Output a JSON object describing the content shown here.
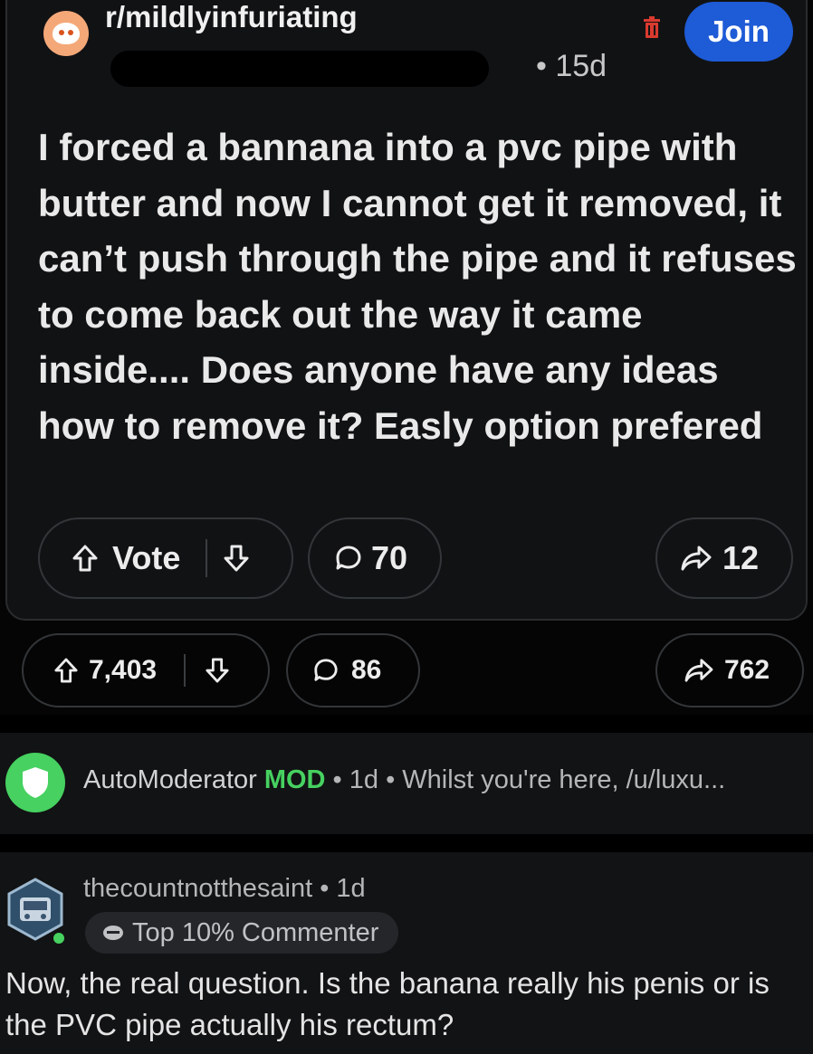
{
  "embedded_post": {
    "subreddit": "r/mildlyinfuriating",
    "age": "• 15d",
    "join_label": "Join",
    "title": "I forced a bannana into a pvc pipe with butter and now I cannot get it removed, it can’t push through the pipe and it refuses to come back out the way it came inside.... Does anyone have any ideas how to remove it? Easly option prefered",
    "vote_label": "Vote",
    "comments": "70",
    "shares": "12"
  },
  "post_actions": {
    "score": "7,403",
    "comments": "86",
    "shares": "762"
  },
  "automod": {
    "name": "AutoModerator",
    "badge": "MOD",
    "meta": " • 1d • Whilst you're here, /u/luxu..."
  },
  "comment": {
    "username": "thecountnotthesaint",
    "age": " • 1d",
    "flair": "Top 10% Commenter",
    "body": "Now, the real question. Is the banana really his penis or is the PVC pipe actually his rectum?"
  },
  "colors": {
    "join_button": "#1e5bd6",
    "mod_green": "#46d160",
    "background": "#050505"
  },
  "icons": [
    "upvote-icon",
    "downvote-icon",
    "comment-icon",
    "share-icon",
    "trash-icon",
    "shield-icon",
    "flair-icon"
  ]
}
